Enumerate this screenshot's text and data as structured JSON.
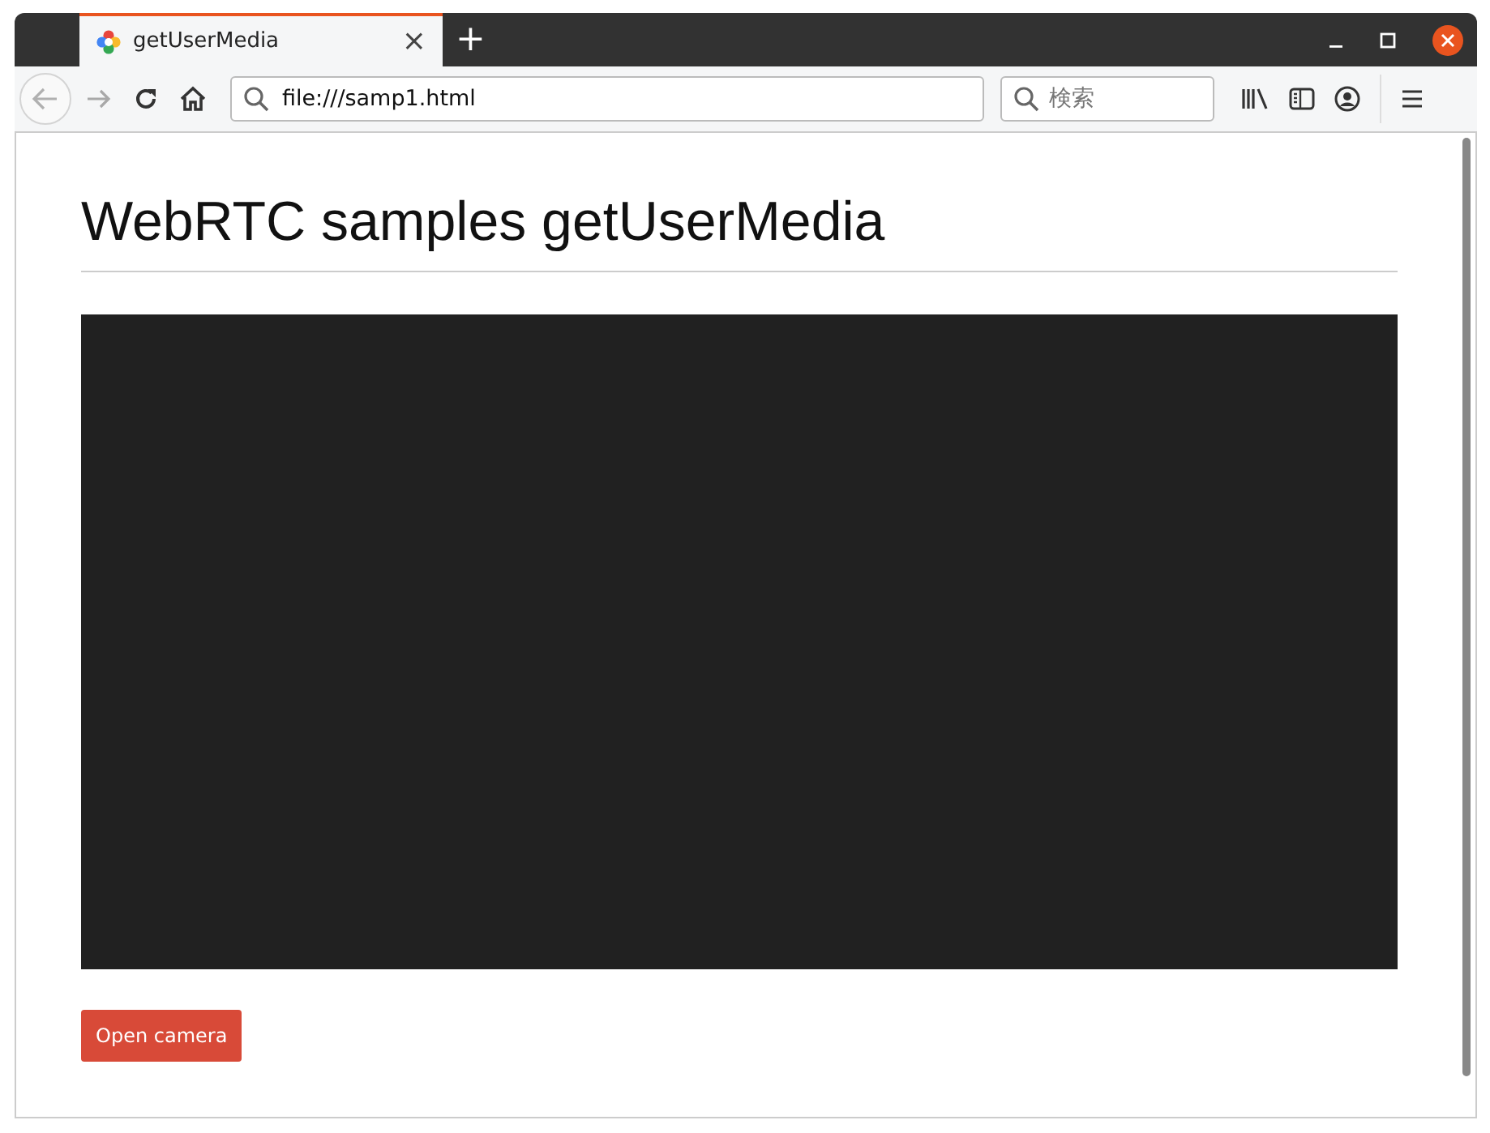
{
  "tabs": [
    {
      "title": "getUserMedia",
      "close": "×",
      "selected": true
    }
  ],
  "new_tab": "+",
  "address_bar": {
    "value": "file:///samp1.html"
  },
  "search": {
    "placeholder": "検索"
  },
  "page": {
    "heading": "WebRTC samples getUserMedia",
    "button": "Open camera"
  }
}
